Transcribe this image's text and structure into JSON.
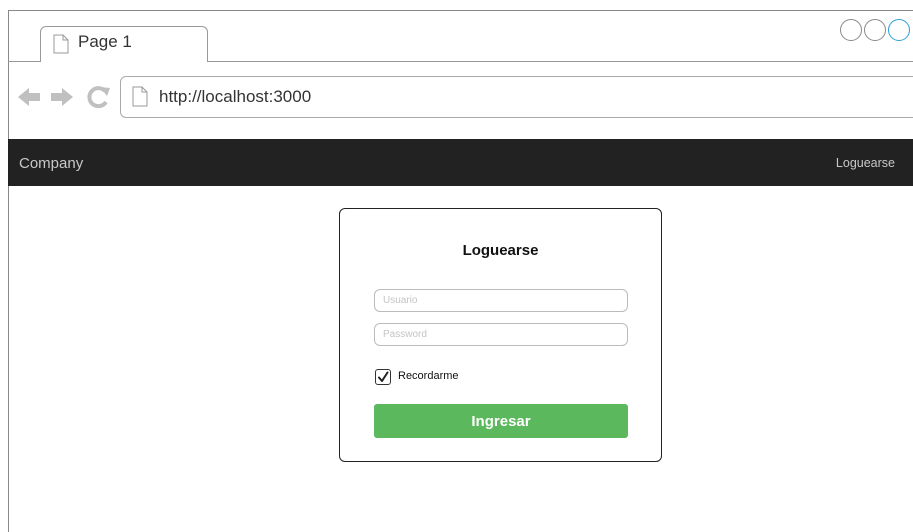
{
  "browser": {
    "tab_title": "Page 1",
    "url": "http://localhost:3000",
    "icons": [
      "document-icon",
      "back-arrow-icon",
      "forward-arrow-icon",
      "refresh-icon",
      "window-control-icon"
    ],
    "accent_circle_color": "#2a9fd8"
  },
  "navbar": {
    "brand": "Company",
    "link": "Loguearse",
    "background": "#222222"
  },
  "login": {
    "title": "Loguearse",
    "username_placeholder": "Usuario",
    "username_value": "",
    "password_placeholder": "Password",
    "password_value": "",
    "remember_label": "Recordarme",
    "remember_checked": true,
    "submit_label": "Ingresar",
    "submit_color": "#5cb85c"
  }
}
